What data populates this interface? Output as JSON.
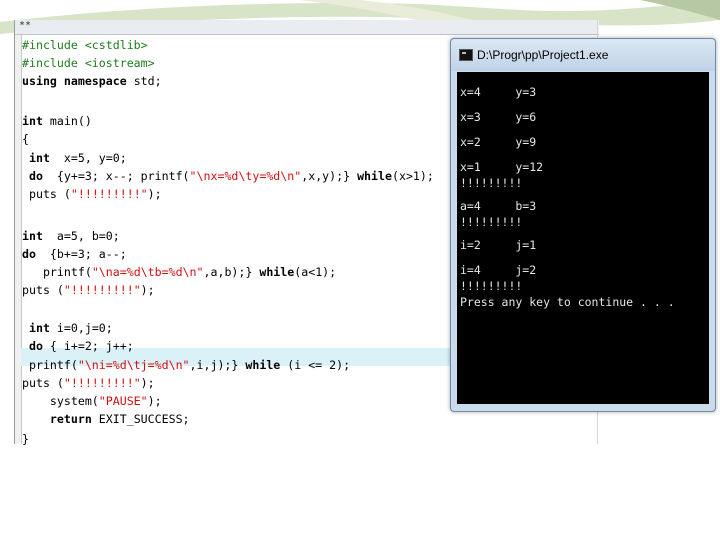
{
  "editor": {
    "tab_mark": "**",
    "lines": [
      "#include <cstdlib>",
      "#include <iostream>",
      "using namespace std;",
      "",
      "int main()",
      "{",
      " int  x=5, y=0;",
      " do  {y+=3; x--; printf(\"\\nx=%d\\ty=%d\\n\",x,y);} while(x>1);",
      " puts (\"!!!!!!!!!\");",
      "",
      "int  a=5, b=0;",
      "do  {b+=3; a--;",
      "   printf(\"\\na=%d\\tb=%d\\n\",a,b);} while(a<1);",
      "puts (\"!!!!!!!!!\");",
      "",
      " int i=0,j=0;",
      " do { i+=2; j++;",
      " printf(\"\\ni=%d\\tj=%d\\n\",i,j);} while (i <= 2);",
      "puts (\"!!!!!!!!!\");",
      "    system(\"PAUSE\");",
      "    return EXIT_SUCCESS;",
      "}"
    ]
  },
  "console": {
    "title": "D:\\Progr\\pp\\Project1.exe",
    "lines": [
      "x=4     y=3",
      "x=3     y=6",
      "x=2     y=9",
      "x=1     y=12",
      "!!!!!!!!!",
      "a=4     b=3",
      "!!!!!!!!!",
      "i=2     j=1",
      "i=4     j=2",
      "!!!!!!!!!",
      "Press any key to continue . . ."
    ]
  },
  "icons": {
    "app": "console-app-icon"
  },
  "colors": {
    "preprocessor": "#1e7d1e",
    "string": "#d01010",
    "highlight": "#d9f1f7",
    "console_bg": "#000000",
    "window_frame": "#c9dbec"
  }
}
